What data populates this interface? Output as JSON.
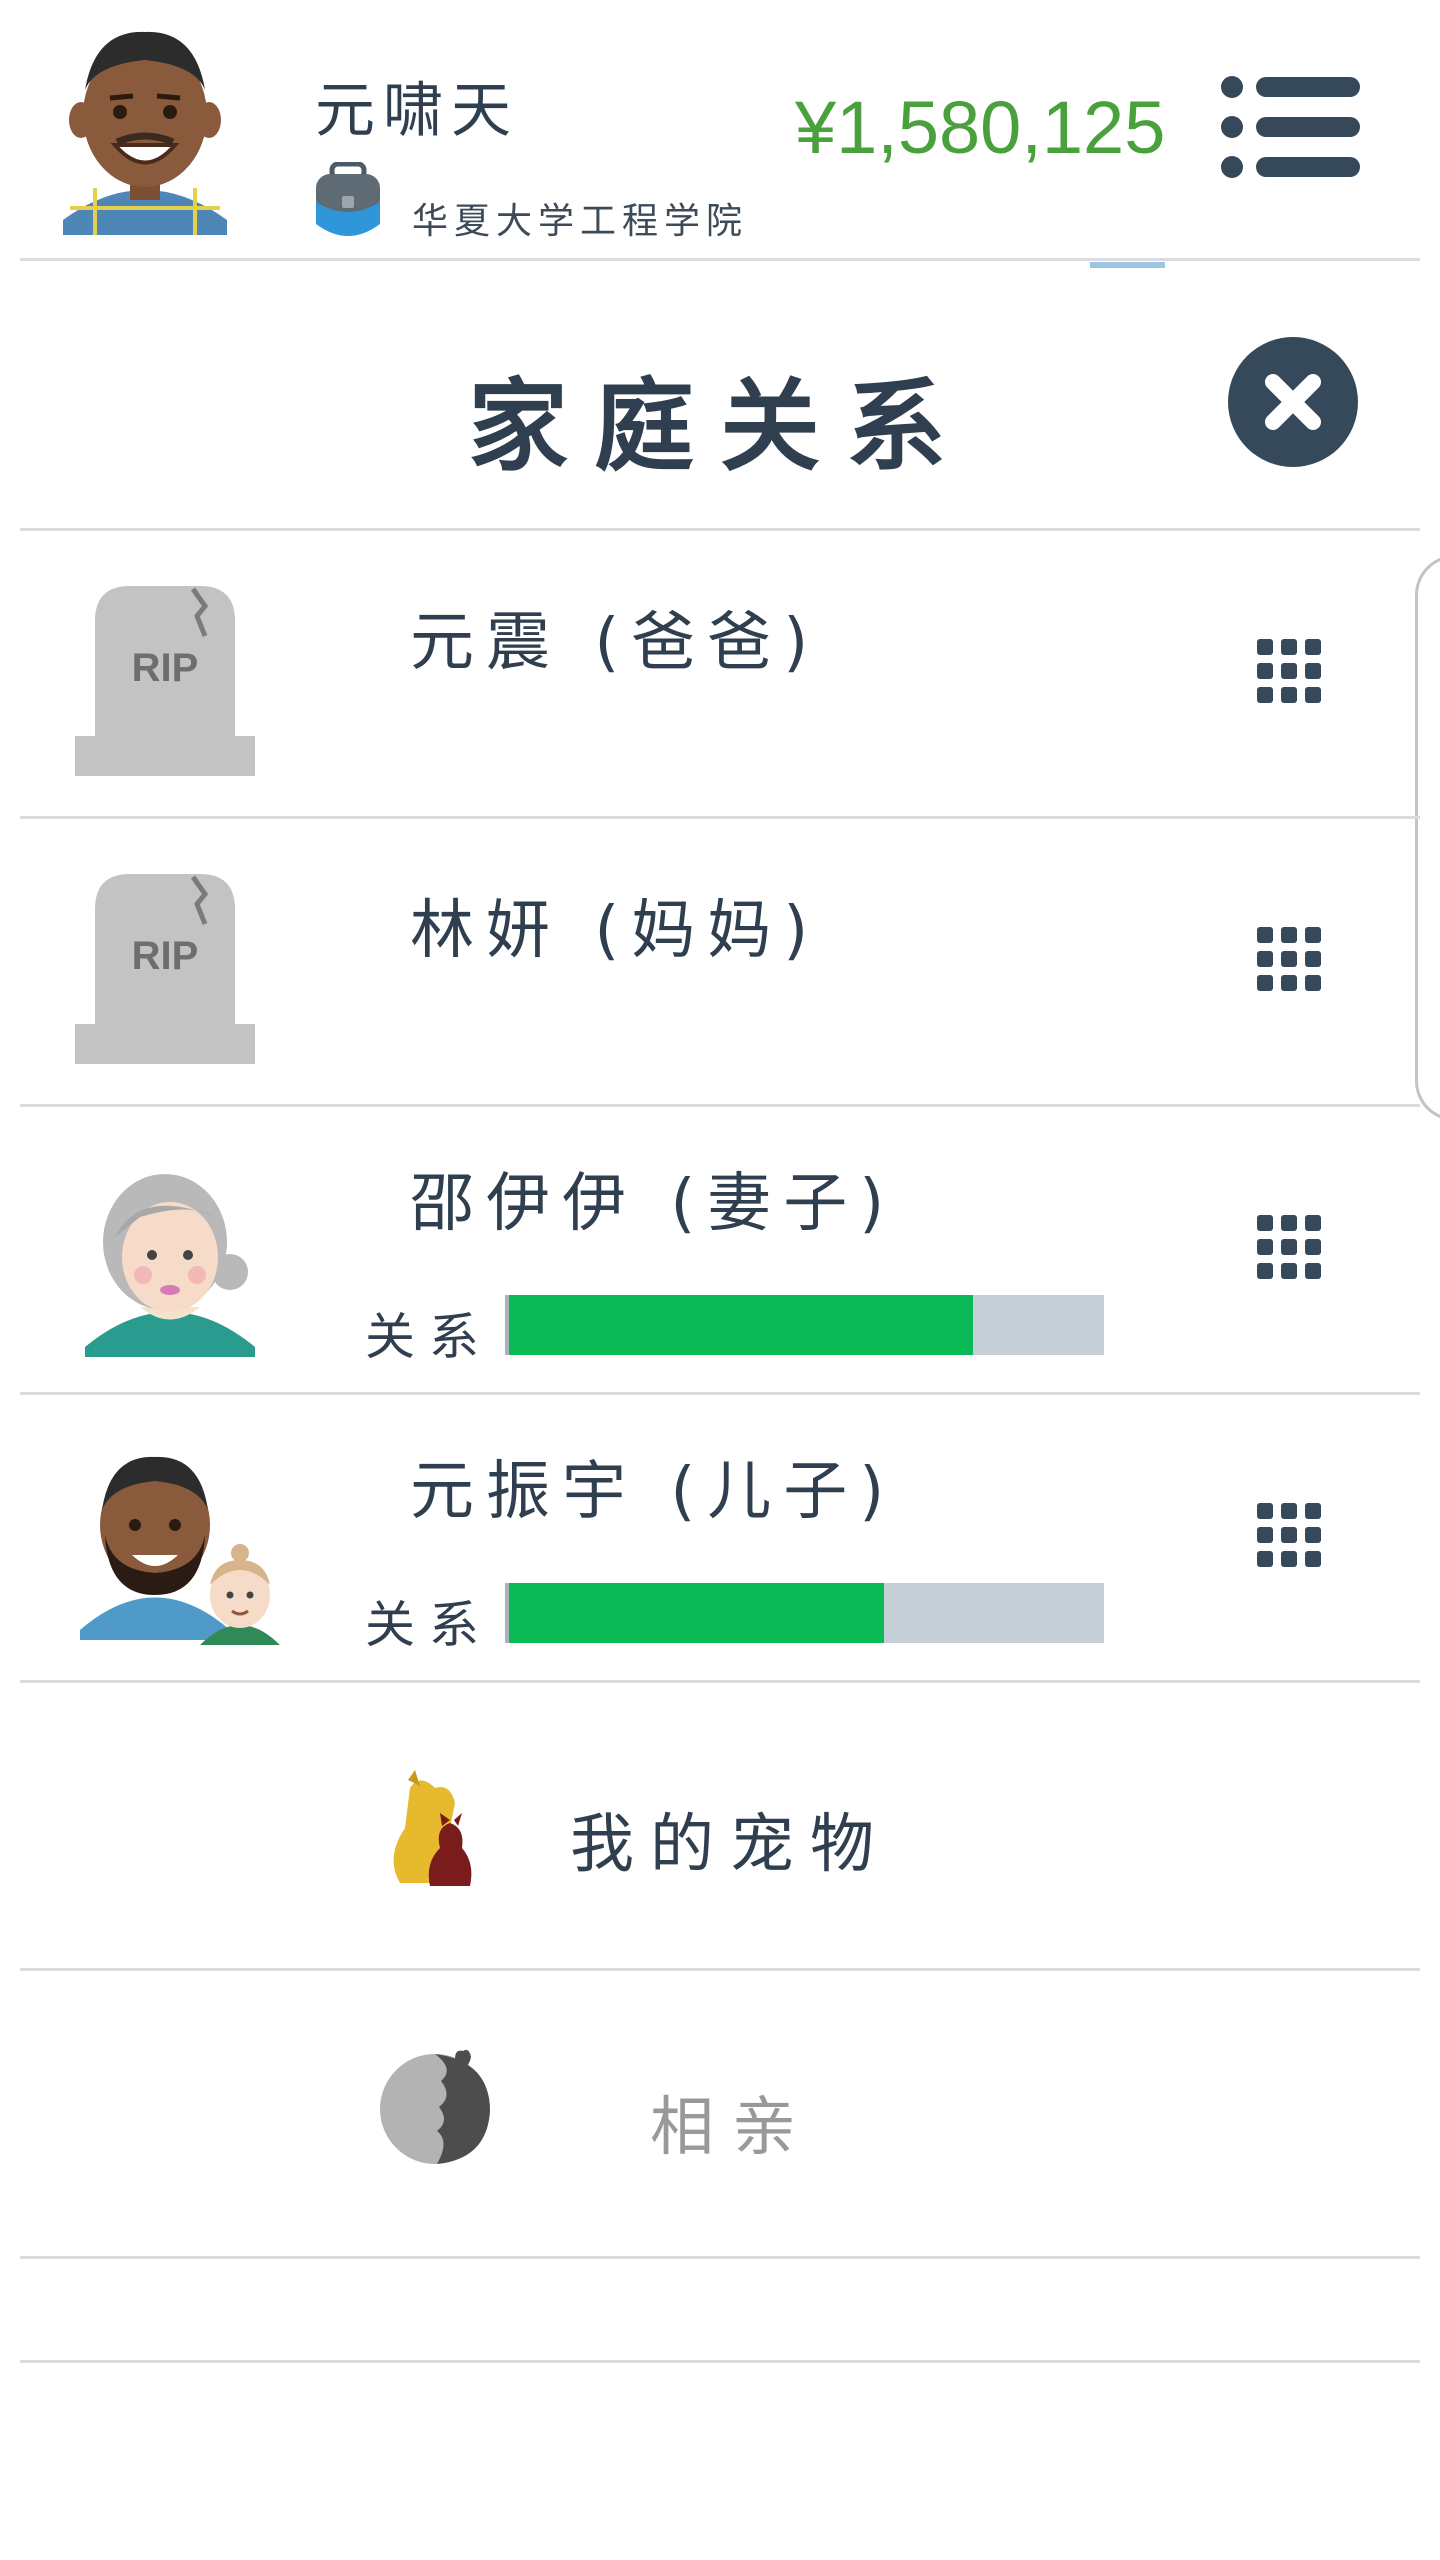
{
  "header": {
    "player_name": "元啸天",
    "school": "华夏大学工程学院",
    "money": "¥1,580,125"
  },
  "icons": {
    "menu": "list-menu-icon",
    "close": "close-icon",
    "options": "grid-dots-icon",
    "school": "backpack-icon",
    "pets": "pets-icon",
    "dating": "dating-hearts-icon"
  },
  "page": {
    "title": "家庭关系"
  },
  "relatives": [
    {
      "name": "元震 (爸爸)",
      "deceased": true
    },
    {
      "name": "林妍 (妈妈)",
      "deceased": true
    },
    {
      "name": "邵伊伊 (妻子)",
      "deceased": false,
      "relationship_label": "关系",
      "relationship_level": 0.78
    },
    {
      "name": "元振宇 (儿子)",
      "deceased": false,
      "relationship_label": "关系",
      "relationship_level": 0.63
    }
  ],
  "tombstone_text": "RIP",
  "links": {
    "pets": "我的宠物",
    "dating": "相亲"
  },
  "colors": {
    "money": "#4aa03c",
    "relationship_fill": "#0bba57",
    "relationship_track": "#c7cfd6",
    "primary_dark": "#36495a",
    "disabled_text": "#999999"
  }
}
